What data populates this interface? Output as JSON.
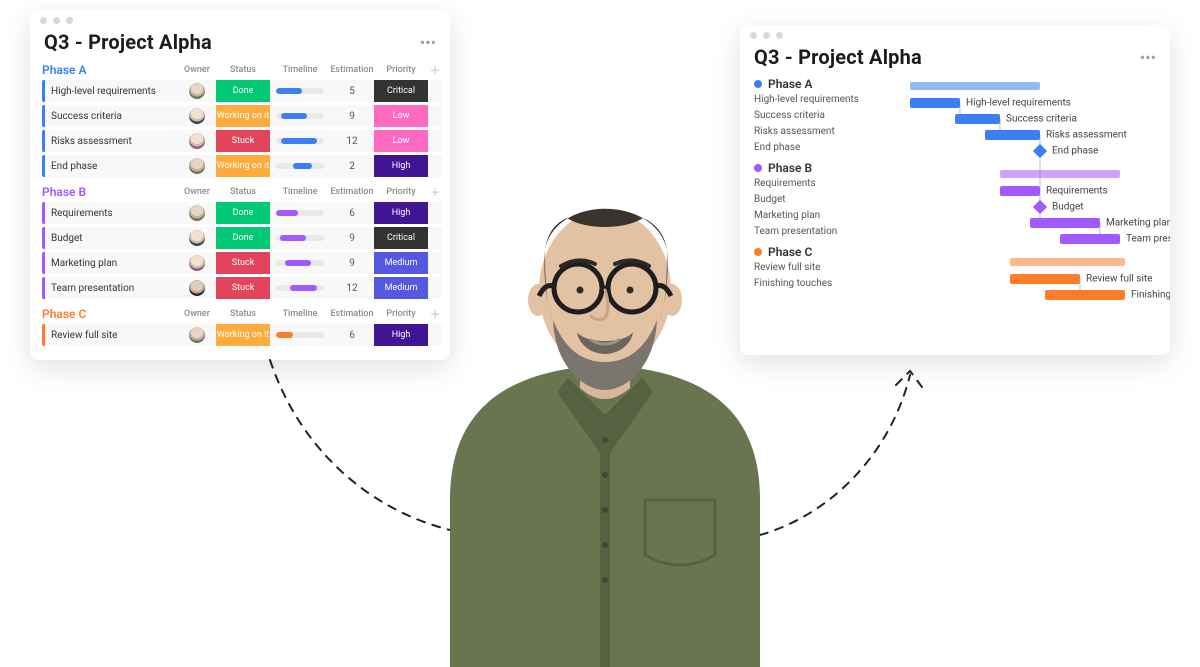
{
  "colors": {
    "blue": "#3a7ff6",
    "purple": "#a259ff",
    "orange": "#ff7c2b",
    "done": "#00c875",
    "working": "#fdab3d",
    "stuck": "#e2445c",
    "critical": "#333333",
    "low": "#ff6ac1",
    "high": "#401694",
    "medium": "#5559df"
  },
  "left": {
    "title": "Q3 - Project Alpha",
    "columns": [
      "Owner",
      "Status",
      "Timeline",
      "Estimation",
      "Priority"
    ],
    "status_labels": {
      "done": "Done",
      "working": "Working on it",
      "stuck": "Stuck"
    },
    "priority_labels": {
      "critical": "Critical",
      "low": "Low",
      "high": "High",
      "medium": "Medium"
    },
    "groups": [
      {
        "name": "Phase A",
        "color": "blue",
        "items": [
          {
            "name": "High-level requirements",
            "owner": "a1",
            "status": "done",
            "tl_start": 0,
            "tl_len": 55,
            "est": 5,
            "priority": "critical"
          },
          {
            "name": "Success criteria",
            "owner": "a2",
            "status": "working",
            "tl_start": 10,
            "tl_len": 55,
            "est": 9,
            "priority": "low"
          },
          {
            "name": "Risks assessment",
            "owner": "a3",
            "status": "stuck",
            "tl_start": 10,
            "tl_len": 75,
            "est": 12,
            "priority": "low"
          },
          {
            "name": "End phase",
            "owner": "a1",
            "status": "working",
            "tl_start": 35,
            "tl_len": 40,
            "est": 2,
            "priority": "high"
          }
        ]
      },
      {
        "name": "Phase B",
        "color": "purple",
        "items": [
          {
            "name": "Requirements",
            "owner": "a1",
            "status": "done",
            "tl_start": 0,
            "tl_len": 45,
            "est": 6,
            "priority": "high"
          },
          {
            "name": "Budget",
            "owner": "a2",
            "status": "done",
            "tl_start": 8,
            "tl_len": 55,
            "est": 9,
            "priority": "critical"
          },
          {
            "name": "Marketing plan",
            "owner": "a3",
            "status": "stuck",
            "tl_start": 18,
            "tl_len": 55,
            "est": 9,
            "priority": "medium"
          },
          {
            "name": "Team presentation",
            "owner": "a4",
            "status": "stuck",
            "tl_start": 30,
            "tl_len": 55,
            "est": 12,
            "priority": "medium"
          }
        ]
      },
      {
        "name": "Phase C",
        "color": "orange",
        "items": [
          {
            "name": "Review full site",
            "owner": "a1",
            "status": "working",
            "tl_start": 0,
            "tl_len": 35,
            "est": 6,
            "priority": "high"
          }
        ]
      }
    ]
  },
  "right": {
    "title": "Q3 - Project Alpha",
    "phases": [
      {
        "name": "Phase A",
        "color": "blue",
        "tasks": [
          {
            "name": "High-level requirements",
            "start": 10,
            "len": 50
          },
          {
            "name": "Success criteria",
            "start": 55,
            "len": 45
          },
          {
            "name": "Risks assessment",
            "start": 85,
            "len": 55
          },
          {
            "name": "End phase",
            "start": 140,
            "len": 0,
            "milestone": true
          }
        ]
      },
      {
        "name": "Phase B",
        "color": "purple",
        "tasks": [
          {
            "name": "Requirements",
            "start": 100,
            "len": 40
          },
          {
            "name": "Budget",
            "start": 140,
            "len": 0,
            "milestone": true
          },
          {
            "name": "Marketing plan",
            "start": 130,
            "len": 70
          },
          {
            "name": "Team presentation",
            "start": 160,
            "len": 60
          }
        ]
      },
      {
        "name": "Phase C",
        "color": "orange",
        "tasks": [
          {
            "name": "Review full site",
            "start": 110,
            "len": 70
          },
          {
            "name": "Finishing touches",
            "start": 145,
            "len": 80
          }
        ]
      }
    ]
  }
}
